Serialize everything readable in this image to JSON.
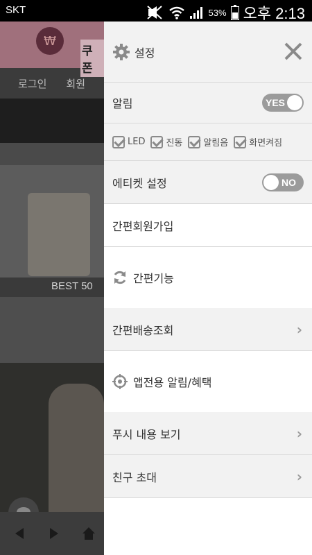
{
  "status_bar": {
    "carrier": "SKT",
    "battery_percent": "53%",
    "time": "오후 2:13"
  },
  "background_app": {
    "brand_logo_symbol": "₩",
    "brand_text": "쿠폰",
    "nav": [
      "로그인",
      "회원"
    ],
    "banner_label": "BEST 50"
  },
  "drawer": {
    "settings": {
      "label": "설정",
      "icon": "gear-icon",
      "close_icon": "close-icon"
    },
    "alarm": {
      "label": "알림",
      "toggle": "YES"
    },
    "alarm_options": [
      {
        "label": "LED",
        "checked": true
      },
      {
        "label": "진동",
        "checked": true
      },
      {
        "label": "알림음",
        "checked": true
      },
      {
        "label": "화면켜짐",
        "checked": true
      }
    ],
    "etiquette": {
      "label": "에티켓 설정",
      "toggle": "NO"
    },
    "easy_join": {
      "label": "간편회원가입"
    },
    "easy_function": {
      "label": "간편기능",
      "icon": "refresh-icon"
    },
    "easy_delivery": {
      "label": "간편배송조회"
    },
    "app_alarm": {
      "label": "앱전용 알림/혜택",
      "icon": "target-icon"
    },
    "push_view": {
      "label": "푸시 내용 보기"
    },
    "invite": {
      "label": "친구 초대"
    }
  }
}
